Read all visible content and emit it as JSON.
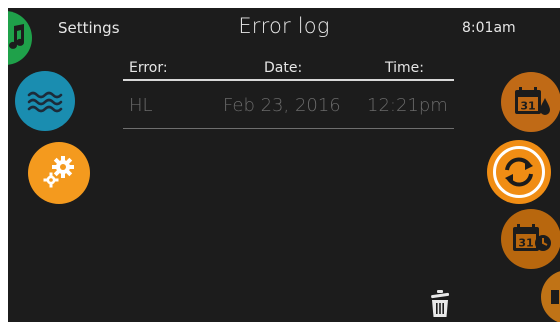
{
  "header": {
    "back_label": "Settings",
    "title": "Error log",
    "time": "8:01am"
  },
  "table": {
    "columns": [
      "Error:",
      "Date:",
      "Time:"
    ],
    "rows": [
      {
        "error": "HL",
        "date": "Feb 23, 2016",
        "time": "12:21pm"
      }
    ]
  },
  "calendar_icon_day": "31",
  "icons": {
    "left": [
      "music-note-icon",
      "waves-icon",
      "gears-icon"
    ],
    "right": [
      "calendar-drop-icon",
      "sync-icon",
      "calendar-clock-icon",
      "next-icon"
    ],
    "bottom": "trash-icon"
  },
  "colors": {
    "background": "#1c1c1c",
    "music": "#1fa14a",
    "water": "#1a8db0",
    "gears": "#f49a1e",
    "orange": "#f08d14",
    "orange_dark": "#c06a16",
    "text": "#e6e6e6",
    "text_dim": "#6a6a6a"
  }
}
